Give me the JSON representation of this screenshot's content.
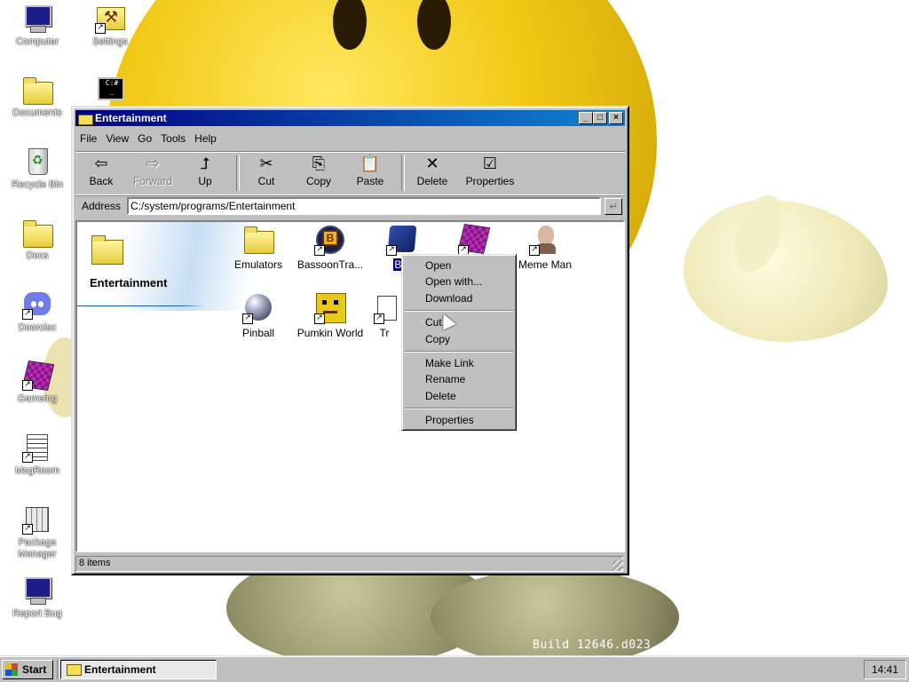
{
  "desktop": {
    "icons": [
      {
        "label": "Computer",
        "icon": "computer-icon"
      },
      {
        "label": "Settings",
        "icon": "settings-icon"
      },
      {
        "label": "Documents",
        "icon": "documents-folder-icon"
      },
      {
        "label": "Recycle Bin",
        "icon": "recycle-bin-icon"
      },
      {
        "label": "Docs",
        "icon": "folder-icon"
      },
      {
        "label": "Doorcisc",
        "icon": "discord-icon"
      },
      {
        "label": "Gameing",
        "icon": "cube-icon"
      },
      {
        "label": "MsgRoom",
        "icon": "msgroom-icon"
      },
      {
        "label": "Package Manager",
        "icon": "package-manager-icon"
      },
      {
        "label": "Report Bug",
        "icon": "report-bug-icon"
      }
    ],
    "build_label": "Build 12646.d023"
  },
  "window": {
    "title": "Entertainment",
    "controls": {
      "minimize": "_",
      "maximize": "□",
      "close": "×"
    },
    "menu": [
      "File",
      "View",
      "Go",
      "Tools",
      "Help"
    ],
    "toolbar": [
      {
        "label": "Back",
        "icon": "back-arrow-icon",
        "glyph": "⇦",
        "enabled": true
      },
      {
        "label": "Forward",
        "icon": "forward-arrow-icon",
        "glyph": "⇨",
        "enabled": false
      },
      {
        "label": "Up",
        "icon": "up-folder-icon",
        "glyph": "⮥",
        "enabled": true
      },
      {
        "label": "Cut",
        "icon": "scissors-icon",
        "glyph": "✂",
        "enabled": true
      },
      {
        "label": "Copy",
        "icon": "copy-icon",
        "glyph": "⎘",
        "enabled": true
      },
      {
        "label": "Paste",
        "icon": "paste-icon",
        "glyph": "📋",
        "enabled": true
      },
      {
        "label": "Delete",
        "icon": "delete-x-icon",
        "glyph": "✕",
        "enabled": true
      },
      {
        "label": "Properties",
        "icon": "properties-icon",
        "glyph": "☑",
        "enabled": true
      }
    ],
    "address": {
      "label": "Address",
      "value": "C:/system/programs/Entertainment",
      "go_glyph": "↵"
    },
    "side_panel": {
      "folder_name": "Entertainment"
    },
    "files": [
      {
        "label": "Emulators",
        "icon": "folder-icon",
        "selected": false
      },
      {
        "label": "BassoonTra...",
        "icon": "bassoon-tracker-icon",
        "selected": false
      },
      {
        "label": "Blo",
        "icon": "blue-box-icon",
        "selected": true
      },
      {
        "label": "",
        "icon": "purple-cube-icon",
        "selected": false
      },
      {
        "label": "Meme Man",
        "icon": "meme-man-icon",
        "selected": false
      },
      {
        "label": "Pinball",
        "icon": "pinball-icon",
        "selected": false
      },
      {
        "label": "Pumkin World",
        "icon": "pumkin-world-icon",
        "selected": false
      },
      {
        "label": "Tr",
        "icon": "tr-app-icon",
        "selected": false
      }
    ],
    "status": "8 items"
  },
  "context_menu": {
    "items": [
      {
        "label": "Open"
      },
      {
        "label": "Open with..."
      },
      {
        "label": "Download"
      },
      {
        "label": "Cut"
      },
      {
        "label": "Copy"
      },
      {
        "label": "Make Link"
      },
      {
        "label": "Rename"
      },
      {
        "label": "Delete"
      },
      {
        "label": "Properties"
      }
    ]
  },
  "taskbar": {
    "start_label": "Start",
    "tasks": [
      {
        "label": "Entertainment",
        "icon": "folder-icon",
        "active": true
      }
    ],
    "clock": "14:41"
  },
  "colors": {
    "titlebar_start": "#000080",
    "titlebar_end": "#1084d0",
    "selection": "#000080",
    "face": "#c0c0c0"
  }
}
